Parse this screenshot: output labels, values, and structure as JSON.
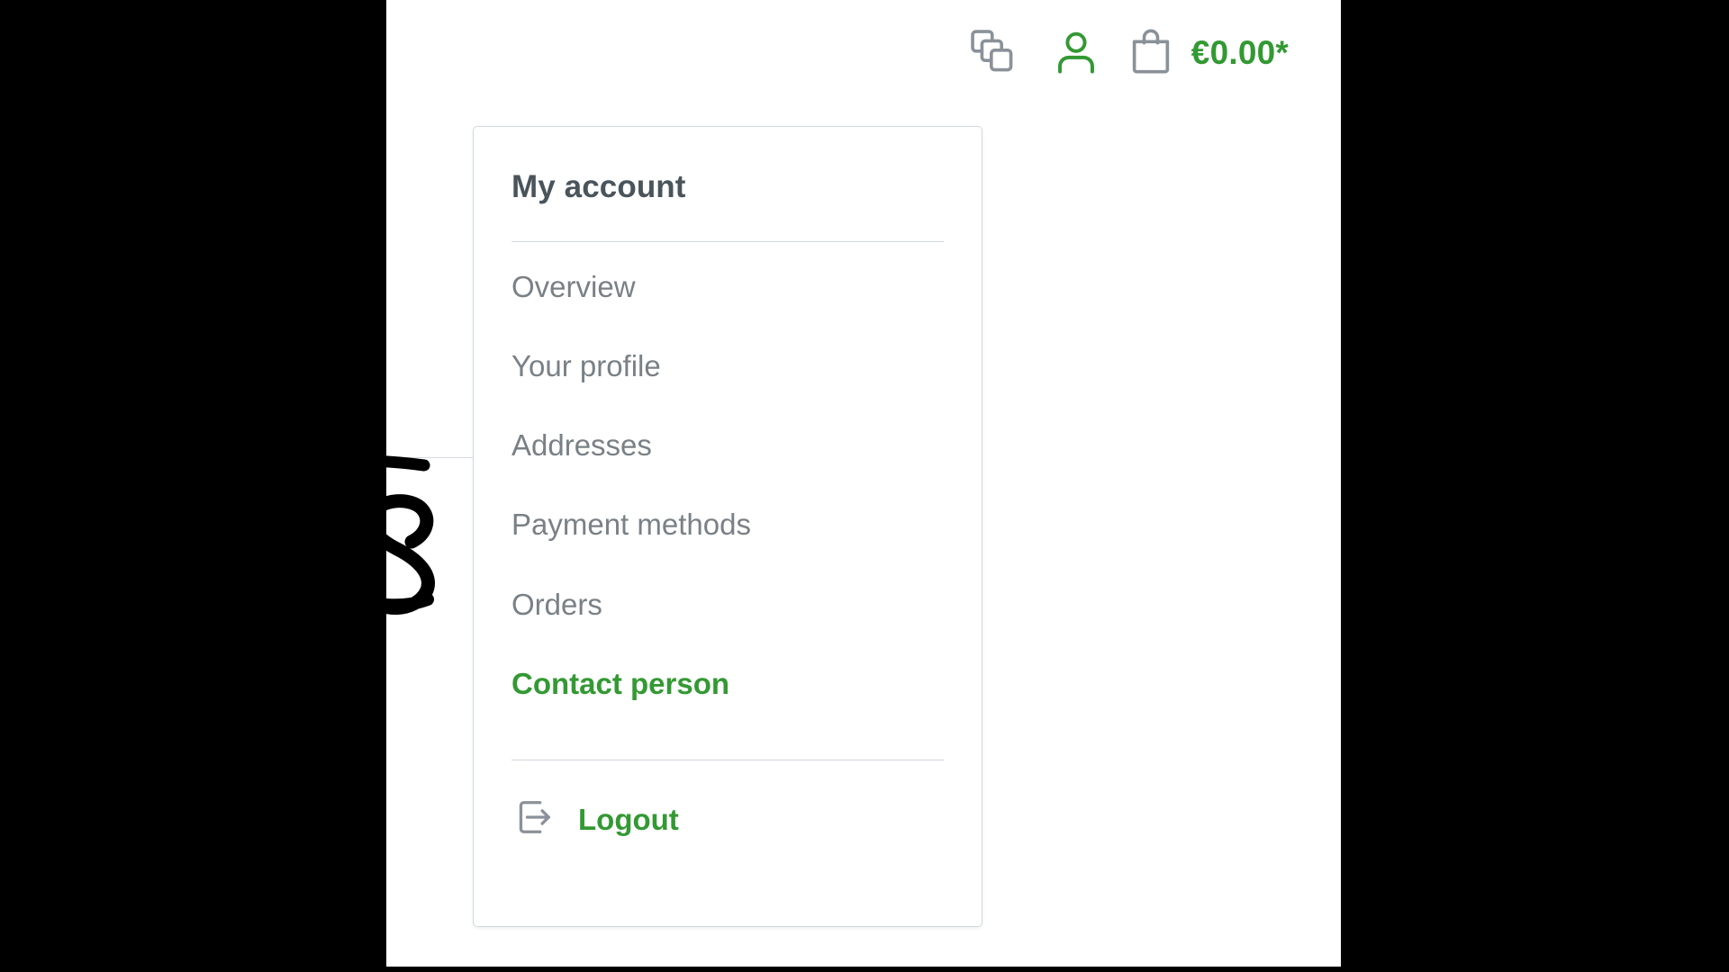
{
  "topbar": {
    "compare_icon": "compare-stack-icon",
    "account_icon": "user-account-icon",
    "cart_icon": "shopping-bag-icon",
    "cart_total": "€0.00*",
    "accent_color": "#339933",
    "icon_gray": "#8a9199"
  },
  "background": {
    "obscured_text_line1": "",
    "obscured_text_line2": "",
    "redaction_note": "black-scribble-redaction"
  },
  "account_dropdown": {
    "title": "My account",
    "items": [
      {
        "label": "Overview",
        "active": false
      },
      {
        "label": "Your profile",
        "active": false
      },
      {
        "label": "Addresses",
        "active": false
      },
      {
        "label": "Payment methods",
        "active": false
      },
      {
        "label": "Orders",
        "active": false
      },
      {
        "label": "Contact person",
        "active": true
      }
    ],
    "logout": {
      "label": "Logout",
      "icon": "logout-icon"
    },
    "border_color": "#d1d9e0",
    "title_color": "#4a545b",
    "item_color": "#798186",
    "active_color": "#339933"
  }
}
